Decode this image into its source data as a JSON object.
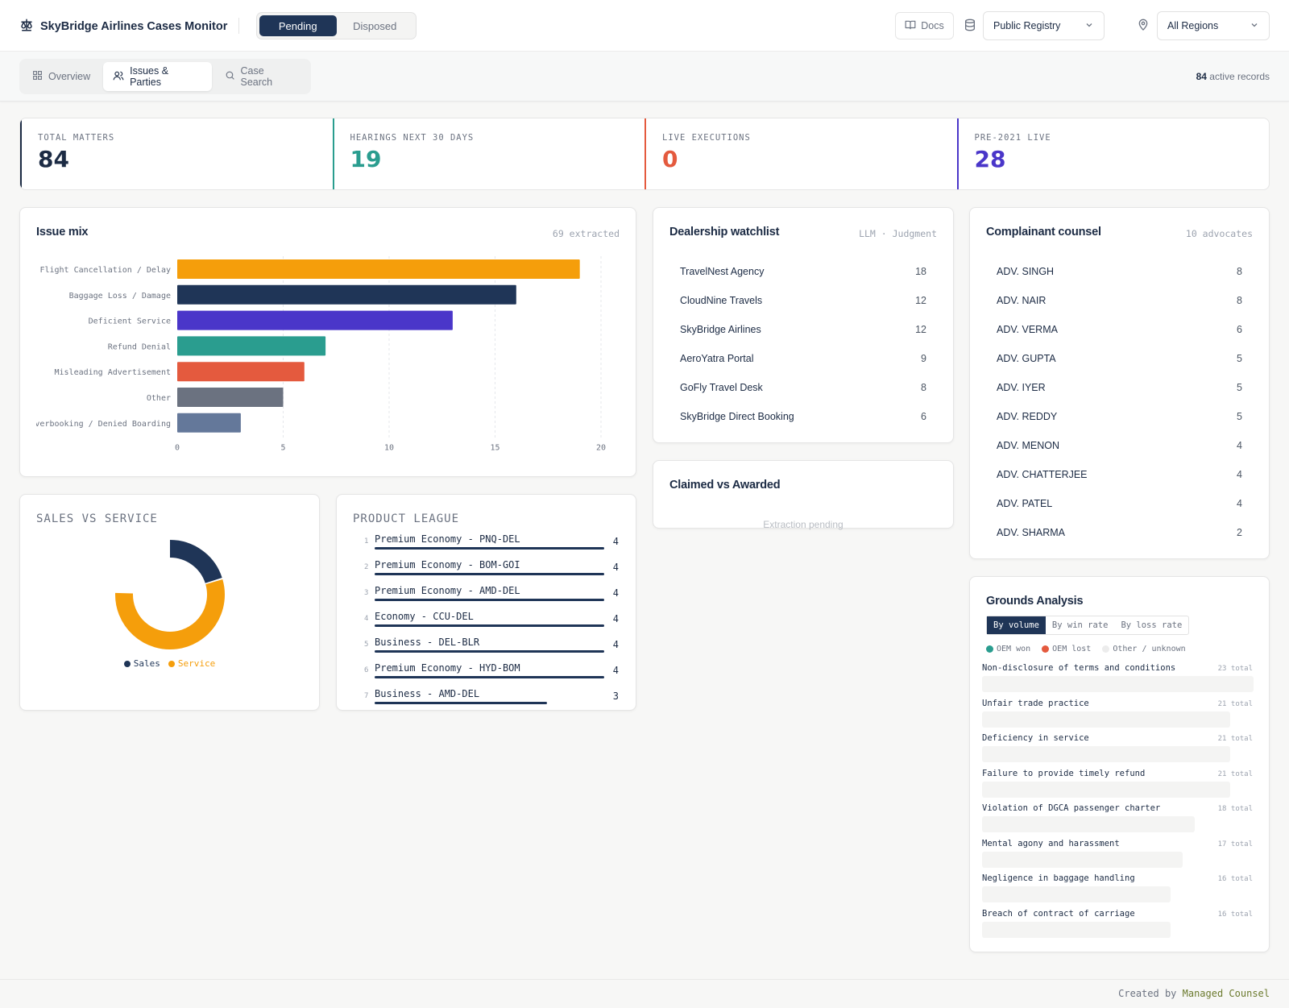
{
  "header": {
    "title": "SkyBridge Airlines Cases Monitor",
    "status_toggle": [
      "Pending",
      "Disposed"
    ],
    "docs_label": "Docs",
    "registry_select": "Public Registry",
    "region_select": "All Regions"
  },
  "nav": {
    "tabs": [
      "Overview",
      "Issues & Parties",
      "Case Search"
    ],
    "active_count": "84",
    "active_suffix": "active records"
  },
  "kpis": [
    {
      "label": "TOTAL MATTERS",
      "value": "84",
      "color": "#1c2b44"
    },
    {
      "label": "HEARINGS NEXT 30 DAYS",
      "value": "19",
      "color": "#2a9d8f"
    },
    {
      "label": "LIVE EXECUTIONS",
      "value": "0",
      "color": "#e45a3e"
    },
    {
      "label": "PRE-2021 LIVE",
      "value": "28",
      "color": "#4a36c9"
    }
  ],
  "issue_mix": {
    "title": "Issue mix",
    "meta": "69 extracted"
  },
  "chart_data": {
    "type": "bar",
    "orientation": "horizontal",
    "categories": [
      "Flight Cancellation / Delay",
      "Baggage Loss / Damage",
      "Deficient Service",
      "Refund Denial",
      "Misleading Advertisement",
      "Other",
      "Overbooking / Denied Boarding"
    ],
    "values": [
      19,
      16,
      13,
      7,
      6,
      5,
      3
    ],
    "colors": [
      "#f59e0b",
      "#1f3557",
      "#4a36c9",
      "#2a9d8f",
      "#e45a3e",
      "#6b7280",
      "#64789a"
    ],
    "xlim": [
      0,
      20
    ],
    "ticks": [
      0,
      5,
      10,
      15,
      20
    ],
    "grid": true
  },
  "dealership": {
    "title": "Dealership watchlist",
    "meta": "LLM · Judgment",
    "items": [
      {
        "name": "TravelNest Agency",
        "count": "18"
      },
      {
        "name": "CloudNine Travels",
        "count": "12"
      },
      {
        "name": "SkyBridge Airlines",
        "count": "12"
      },
      {
        "name": "AeroYatra Portal",
        "count": "9"
      },
      {
        "name": "GoFly Travel Desk",
        "count": "8"
      },
      {
        "name": "SkyBridge Direct Booking",
        "count": "6"
      }
    ]
  },
  "claimed": {
    "title": "Claimed vs Awarded",
    "note": "Extraction pending"
  },
  "counsel": {
    "title": "Complainant counsel",
    "meta": "10 advocates",
    "items": [
      {
        "name": "ADV. SINGH",
        "count": "8"
      },
      {
        "name": "ADV. NAIR",
        "count": "8"
      },
      {
        "name": "ADV. VERMA",
        "count": "6"
      },
      {
        "name": "ADV. GUPTA",
        "count": "5"
      },
      {
        "name": "ADV. IYER",
        "count": "5"
      },
      {
        "name": "ADV. REDDY",
        "count": "5"
      },
      {
        "name": "ADV. MENON",
        "count": "4"
      },
      {
        "name": "ADV. CHATTERJEE",
        "count": "4"
      },
      {
        "name": "ADV. PATEL",
        "count": "4"
      },
      {
        "name": "ADV. SHARMA",
        "count": "2"
      }
    ]
  },
  "sales_service": {
    "title": "SALES VS SERVICE",
    "donut": [
      {
        "name": "Sales",
        "share": 0.2,
        "color": "#1f3557"
      },
      {
        "name": "Service",
        "share": 0.55,
        "color": "#f59e0b"
      }
    ]
  },
  "product_league": {
    "title": "PRODUCT LEAGUE",
    "max": 4,
    "items": [
      {
        "rank": "1",
        "name": "Premium Economy - PNQ-DEL",
        "count": 4
      },
      {
        "rank": "2",
        "name": "Premium Economy - BOM-GOI",
        "count": 4
      },
      {
        "rank": "3",
        "name": "Premium Economy - AMD-DEL",
        "count": 4
      },
      {
        "rank": "4",
        "name": "Economy - CCU-DEL",
        "count": 4
      },
      {
        "rank": "5",
        "name": "Business - DEL-BLR",
        "count": 4
      },
      {
        "rank": "6",
        "name": "Premium Economy - HYD-BOM",
        "count": 4
      },
      {
        "rank": "7",
        "name": "Business - AMD-DEL",
        "count": 3
      }
    ]
  },
  "grounds": {
    "title": "Grounds Analysis",
    "tabs": [
      "By volume",
      "By win rate",
      "By loss rate"
    ],
    "legend": [
      {
        "label": "OEM won",
        "color": "#2a9d8f"
      },
      {
        "label": "OEM lost",
        "color": "#e45a3e"
      },
      {
        "label": "Other / unknown",
        "color": "#ececec"
      }
    ],
    "max": 23,
    "items": [
      {
        "name": "Non-disclosure of terms and conditions",
        "total": 23,
        "total_label": "23 total"
      },
      {
        "name": "Unfair trade practice",
        "total": 21,
        "total_label": "21 total"
      },
      {
        "name": "Deficiency in service",
        "total": 21,
        "total_label": "21 total"
      },
      {
        "name": "Failure to provide timely refund",
        "total": 21,
        "total_label": "21 total"
      },
      {
        "name": "Violation of DGCA passenger charter",
        "total": 18,
        "total_label": "18 total"
      },
      {
        "name": "Mental agony and harassment",
        "total": 17,
        "total_label": "17 total"
      },
      {
        "name": "Negligence in baggage handling",
        "total": 16,
        "total_label": "16 total"
      },
      {
        "name": "Breach of contract of carriage",
        "total": 16,
        "total_label": "16 total"
      }
    ]
  },
  "footer": {
    "prefix": "Created by",
    "brand": "Managed Counsel"
  }
}
